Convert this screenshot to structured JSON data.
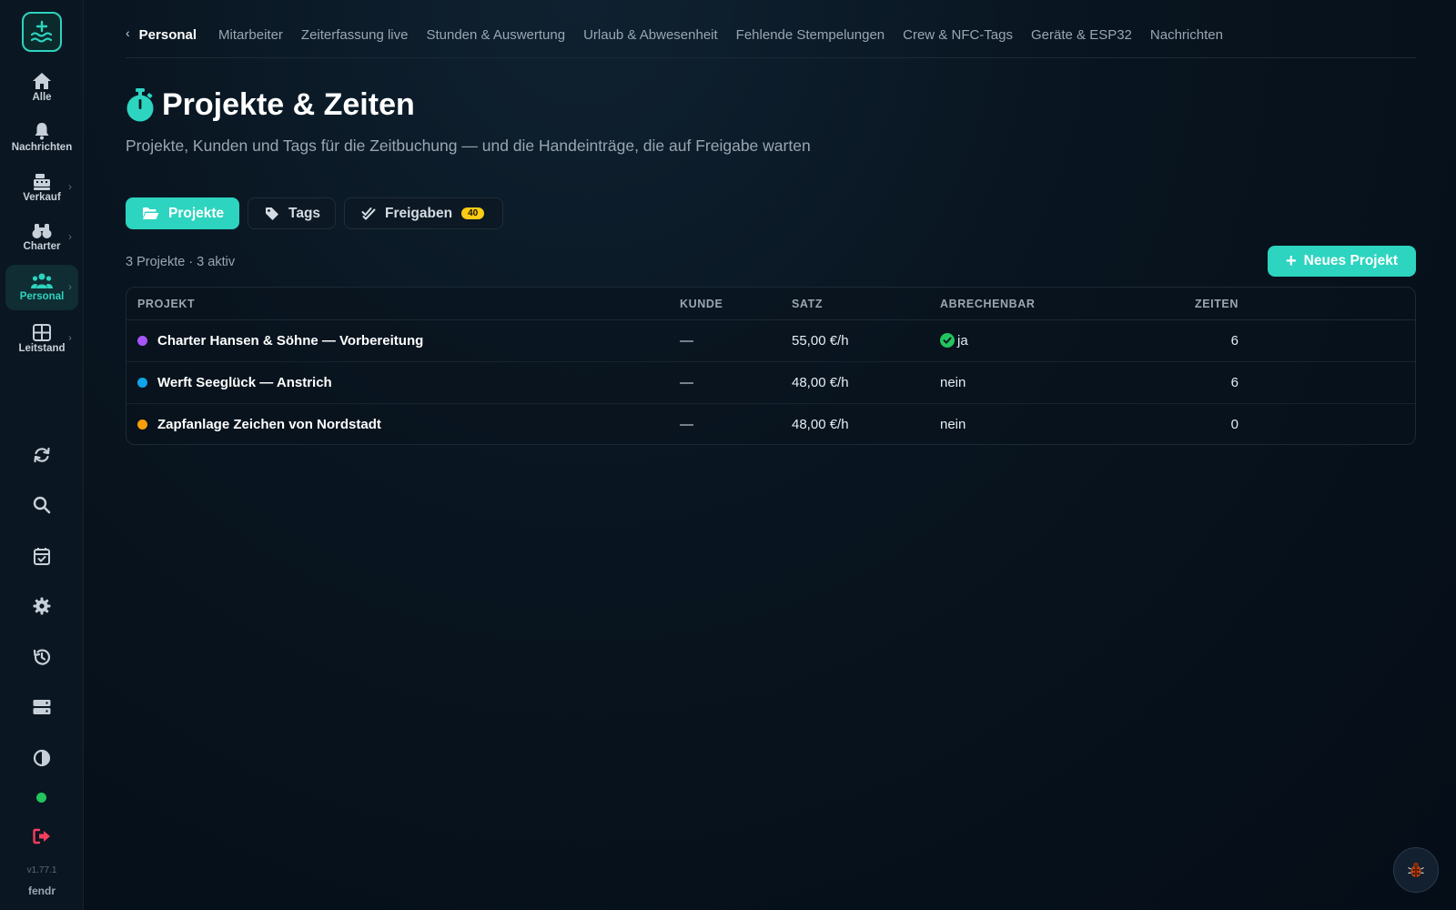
{
  "sidebar": {
    "items": [
      {
        "label": "Alle",
        "icon": "home-icon"
      },
      {
        "label": "Nachrichten",
        "icon": "bell-icon"
      },
      {
        "label": "Verkauf",
        "icon": "cash-register-icon"
      },
      {
        "label": "Charter",
        "icon": "binoculars-icon"
      },
      {
        "label": "Personal",
        "icon": "users-icon",
        "active": true
      },
      {
        "label": "Leitstand",
        "icon": "grid-icon"
      }
    ],
    "version": "v1.77.1",
    "user": "fendr"
  },
  "topnav": {
    "section": "Personal",
    "tabs": [
      "Mitarbeiter",
      "Zeiterfassung live",
      "Stunden & Auswertung",
      "Urlaub & Abwesenheit",
      "Fehlende Stempelungen",
      "Crew & NFC-Tags",
      "Geräte & ESP32",
      "Nachrichten"
    ]
  },
  "header": {
    "title": "Projekte & Zeiten",
    "subtitle": "Projekte, Kunden und Tags für die Zeitbuchung — und die Handeinträge, die auf Freigabe warten"
  },
  "tabs": {
    "projekte": "Projekte",
    "tags": "Tags",
    "freigaben": "Freigaben",
    "freigaben_count": "40"
  },
  "summary": "3 Projekte · 3 aktiv",
  "new_button": "Neues Projekt",
  "table": {
    "headers": {
      "projekt": "PROJEKT",
      "kunde": "KUNDE",
      "satz": "SATZ",
      "abrechenbar": "ABRECHENBAR",
      "zeiten": "ZEITEN"
    },
    "rows": [
      {
        "name": "Charter Hansen & Söhne — Vorbereitung",
        "color": "#a855f7",
        "kunde": "—",
        "satz": "55,00 €/h",
        "abrechenbar": "ja",
        "billable": true,
        "zeiten": "6"
      },
      {
        "name": "Werft Seeglück — Anstrich",
        "color": "#0ea5e9",
        "kunde": "—",
        "satz": "48,00 €/h",
        "abrechenbar": "nein",
        "billable": false,
        "zeiten": "6"
      },
      {
        "name": "Zapfanlage Zeichen von Nordstadt",
        "color": "#f59e0b",
        "kunde": "—",
        "satz": "48,00 €/h",
        "abrechenbar": "nein",
        "billable": false,
        "zeiten": "0"
      }
    ]
  },
  "colors": {
    "accent": "#2dd4bf",
    "online": "#22c55e",
    "logout": "#f43f5e",
    "badge": "#facc15"
  }
}
